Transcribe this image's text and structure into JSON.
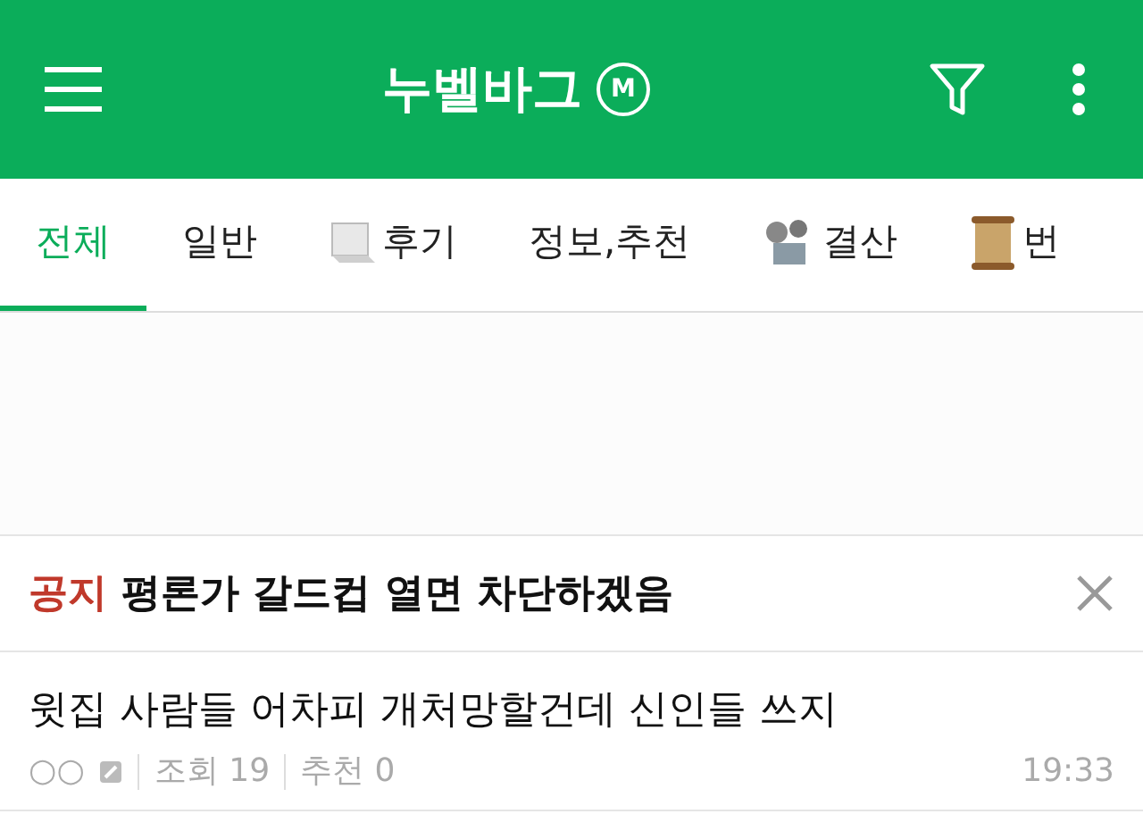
{
  "header": {
    "title": "누벨바그",
    "badge": "M"
  },
  "tabs": [
    {
      "label": "전체",
      "kind": "plain",
      "selected": true
    },
    {
      "label": "일반",
      "kind": "plain",
      "selected": false
    },
    {
      "label": "후기",
      "kind": "paper",
      "selected": false
    },
    {
      "label": "정보,추천",
      "kind": "plain",
      "selected": false
    },
    {
      "label": "결산",
      "kind": "projector",
      "selected": false
    },
    {
      "label": "번",
      "kind": "scroll",
      "selected": false
    }
  ],
  "notice": {
    "tag": "공지",
    "title": "평론가 갈드컵 열면 차단하겠음"
  },
  "posts": [
    {
      "title": "윗집 사람들 어차피 개처망할건데 신인들 쓰지",
      "author": "○○",
      "views": "조회 19",
      "likes": "추천 0",
      "time": "19:33"
    }
  ]
}
